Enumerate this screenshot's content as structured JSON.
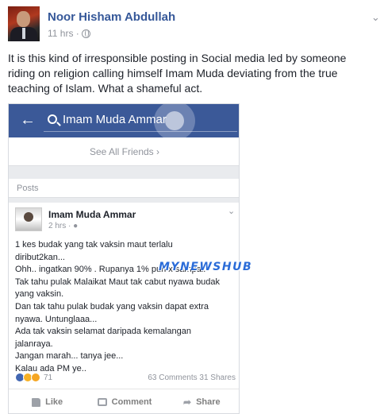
{
  "post": {
    "author": "Noor Hisham Abdullah",
    "time": "11 hrs ·",
    "text": "It is this kind of irresponsible posting in Social media led by someone riding on religion calling himself Imam Muda deviating from the true teaching of Islam. What a shameful act."
  },
  "shared_screenshot": {
    "search_query": "Imam Muda Ammar",
    "see_all_friends": "See All Friends",
    "posts_label": "Posts",
    "card": {
      "author": "Imam Muda Ammar",
      "time": "2 hrs ·",
      "lines": [
        "1 kes budak yang tak vaksin maut terlalu",
        "diribut2kan...",
        "Ohh.. ingatkan 90% . Rupanya 1% pun x sampai.",
        "Tak tahu pulak Malaikat Maut tak cabut nyawa budak",
        "yang vaksin.",
        "Dan tak tahu pulak budak yang vaksin dapat extra",
        "nyawa. Untunglaaa...",
        "Ada tak vaksin selamat daripada kemalangan",
        "jalanraya.",
        "Jangan marah... tanya jee...",
        "Kalau ada PM ye.."
      ],
      "reaction_count": "71",
      "counts": "63 Comments  31 Shares",
      "actions": {
        "like": "Like",
        "comment": "Comment",
        "share": "Share"
      }
    },
    "watermark": "MYNEWSHUB"
  },
  "icons": {
    "chevron": "chevron-down-icon",
    "globe": "globe-icon",
    "back": "back-arrow-icon",
    "search": "search-icon"
  },
  "colors": {
    "facebook_blue": "#3b5998",
    "link_blue": "#365899"
  }
}
